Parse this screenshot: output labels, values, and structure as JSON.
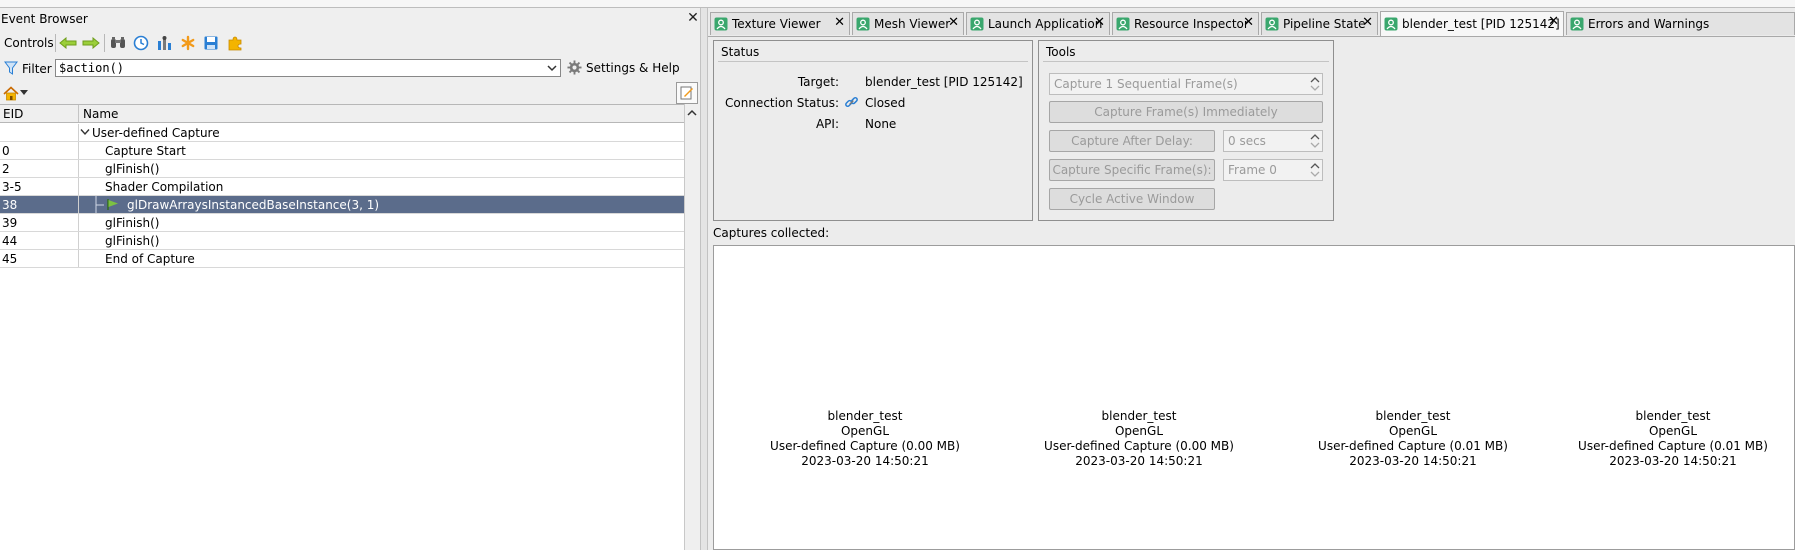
{
  "event_browser": {
    "title": "Event Browser",
    "controls_label": "Controls",
    "filter_label": "Filter",
    "filter_value": "$action()",
    "settings_label": "Settings & Help",
    "columns": [
      "EID",
      "Name"
    ],
    "rows": [
      {
        "eid": "",
        "name": "User-defined Capture",
        "indent": 0,
        "expanded": true
      },
      {
        "eid": "0",
        "name": "Capture Start",
        "indent": 1
      },
      {
        "eid": "2",
        "name": "glFinish()",
        "indent": 1
      },
      {
        "eid": "3-5",
        "name": "Shader Compilation",
        "indent": 1
      },
      {
        "eid": "38",
        "name": "glDrawArraysInstancedBaseInstance(3, 1)",
        "indent": 2,
        "selected": true
      },
      {
        "eid": "39",
        "name": "glFinish()",
        "indent": 1
      },
      {
        "eid": "44",
        "name": "glFinish()",
        "indent": 1
      },
      {
        "eid": "45",
        "name": "End of Capture",
        "indent": 1
      }
    ]
  },
  "tabs": [
    {
      "label": "Texture Viewer",
      "active": false
    },
    {
      "label": "Mesh Viewer",
      "active": false
    },
    {
      "label": "Launch Application",
      "active": false
    },
    {
      "label": "Resource Inspector",
      "active": false
    },
    {
      "label": "Pipeline State",
      "active": false
    },
    {
      "label": "blender_test [PID 125142]",
      "active": true
    },
    {
      "label": "Errors and Warnings",
      "active": false
    }
  ],
  "status": {
    "title": "Status",
    "target_label": "Target:",
    "target_value": "blender_test [PID 125142]",
    "connection_label": "Connection Status:",
    "connection_value": "Closed",
    "api_label": "API:",
    "api_value": "None"
  },
  "tools": {
    "title": "Tools",
    "sequential_frames": "Capture 1 Sequential Frame(s)",
    "capture_immediately": "Capture Frame(s) Immediately",
    "capture_after_delay": "Capture After Delay:",
    "delay_value": "0 secs",
    "capture_specific": "Capture Specific Frame(s):",
    "frame_value": "Frame 0",
    "cycle_window": "Cycle Active Window"
  },
  "captures": {
    "label": "Captures collected:",
    "items": [
      {
        "name": "blender_test",
        "api": "OpenGL",
        "desc": "User-defined Capture (0.00 MB)",
        "time": "2023-03-20 14:50:21"
      },
      {
        "name": "blender_test",
        "api": "OpenGL",
        "desc": "User-defined Capture (0.00 MB)",
        "time": "2023-03-20 14:50:21"
      },
      {
        "name": "blender_test",
        "api": "OpenGL",
        "desc": "User-defined Capture (0.01 MB)",
        "time": "2023-03-20 14:50:21"
      },
      {
        "name": "blender_test",
        "api": "OpenGL",
        "desc": "User-defined Capture (0.01 MB)",
        "time": "2023-03-20 14:50:21"
      }
    ]
  },
  "colors": {
    "selection": "#5b6c8b",
    "tab_icon": "#3aa76d",
    "toolbar_green": "#8cc63f"
  }
}
